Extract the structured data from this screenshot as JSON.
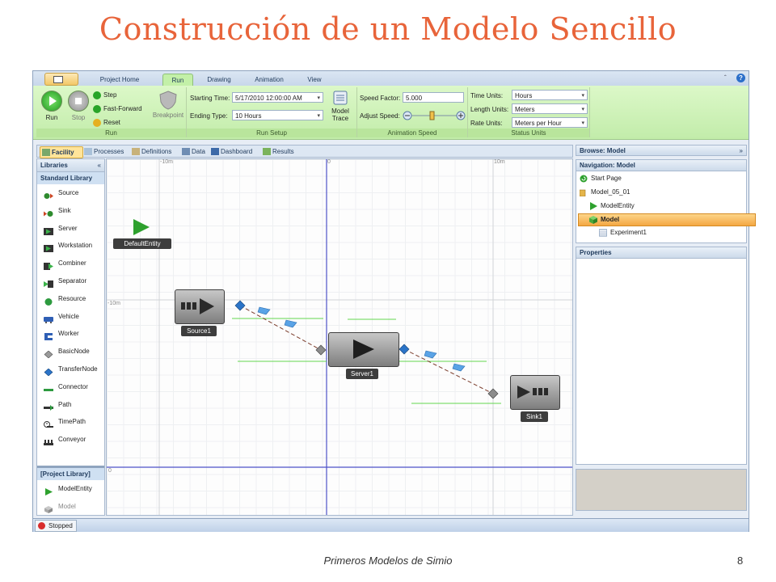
{
  "slide": {
    "title": "Construcción de un Modelo Sencillo",
    "footer_text": "Primeros Modelos de Simio",
    "page_number": "8"
  },
  "tabs": [
    "Project Home",
    "Run",
    "Drawing",
    "Animation",
    "View"
  ],
  "active_tab": "Run",
  "ribbon": {
    "run_group": {
      "run": "Run",
      "stop": "Stop",
      "step": "Step",
      "fast_forward": "Fast-Forward",
      "reset": "Reset",
      "breakpoint": "Breakpoint",
      "label": "Run"
    },
    "run_setup": {
      "starting_time_label": "Starting Time:",
      "starting_time_value": "5/17/2010 12:00:00 AM",
      "ending_type_label": "Ending Type:",
      "ending_type_value": "10 Hours",
      "model_trace_line1": "Model",
      "model_trace_line2": "Trace",
      "label": "Run Setup"
    },
    "animation_speed": {
      "speed_factor_label": "Speed Factor:",
      "speed_factor_value": "5.000",
      "adjust_speed_label": "Adjust Speed:",
      "label": "Animation Speed"
    },
    "status_units": {
      "time_units_label": "Time Units:",
      "time_units_value": "Hours",
      "length_units_label": "Length Units:",
      "length_units_value": "Meters",
      "rate_units_label": "Rate Units:",
      "rate_units_value": "Meters per Hour",
      "label": "Status Units"
    }
  },
  "view_tabs": [
    "Facility",
    "Processes",
    "Definitions",
    "Data",
    "Dashboard",
    "Results"
  ],
  "active_view_tab": "Facility",
  "libraries": {
    "header": "Libraries",
    "collapse": "«",
    "standard_title": "Standard Library",
    "standard_items": [
      "Source",
      "Sink",
      "Server",
      "Workstation",
      "Combiner",
      "Separator",
      "Resource",
      "Vehicle",
      "Worker",
      "BasicNode",
      "TransferNode",
      "Connector",
      "Path",
      "TimePath",
      "Conveyor"
    ],
    "project_title": "[Project Library]",
    "project_items": [
      "ModelEntity",
      "Model"
    ]
  },
  "canvas": {
    "axis_labels": [
      "-10m",
      "0",
      "10m",
      "-10m",
      "0"
    ],
    "objects": {
      "default_entity": "DefaultEntity",
      "source": "Source1",
      "server": "Server1",
      "sink": "Sink1"
    }
  },
  "browse": {
    "title": "Browse: Model",
    "expand": "»",
    "navigation_title": "Navigation: Model",
    "nav_items": [
      "Start Page",
      "Model_05_01",
      "ModelEntity",
      "Model",
      "Experiment1"
    ],
    "selected": "Model",
    "properties_title": "Properties"
  },
  "status": {
    "state": "Stopped"
  },
  "colors": {
    "title": "#e8643a",
    "ribbon": "#c2ecaa",
    "selection": "#f4a743",
    "entity_green": "#2ea12e"
  }
}
